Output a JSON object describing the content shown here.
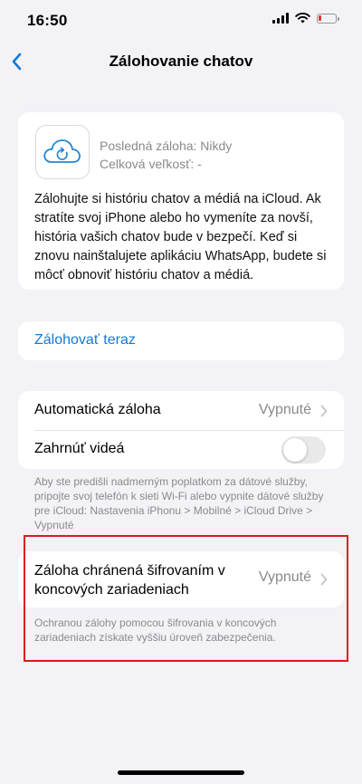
{
  "status_bar": {
    "time": "16:50"
  },
  "nav": {
    "title": "Zálohovanie chatov"
  },
  "backup_info": {
    "last_backup": "Posledná záloha: Nikdy",
    "total_size": "Celková veľkosť: -",
    "description": "Zálohujte si históriu chatov a médiá na iCloud. Ak stratíte svoj iPhone alebo ho vymeníte za novší, história vašich chatov bude v bezpečí. Keď si znovu nainštalujete aplikáciu WhatsApp, budete si môcť obnoviť históriu chatov a médiá."
  },
  "backup_now": {
    "label": "Zálohovať teraz"
  },
  "settings": {
    "auto_backup_label": "Automatická záloha",
    "auto_backup_value": "Vypnuté",
    "include_videos_label": "Zahrnúť videá",
    "include_videos_on": false
  },
  "footnote_wifi": "Aby ste predišli nadmerným poplatkom za dátové služby, pripojte svoj telefón k sieti Wi-Fi alebo vypnite dátové služby pre iCloud: Nastavenia iPhonu > Mobilné > iCloud Drive > Vypnuté",
  "e2e_backup": {
    "label": "Záloha chránená šifrovaním v koncových zariadeniach",
    "value": "Vypnuté",
    "footnote": "Ochranou zálohy pomocou šifrovania v koncových zariadeniach získate vyššiu úroveň zabezpečenia."
  },
  "colors": {
    "accent": "#1279d6",
    "background": "#f2f2f7",
    "highlight": "#e3151c"
  }
}
